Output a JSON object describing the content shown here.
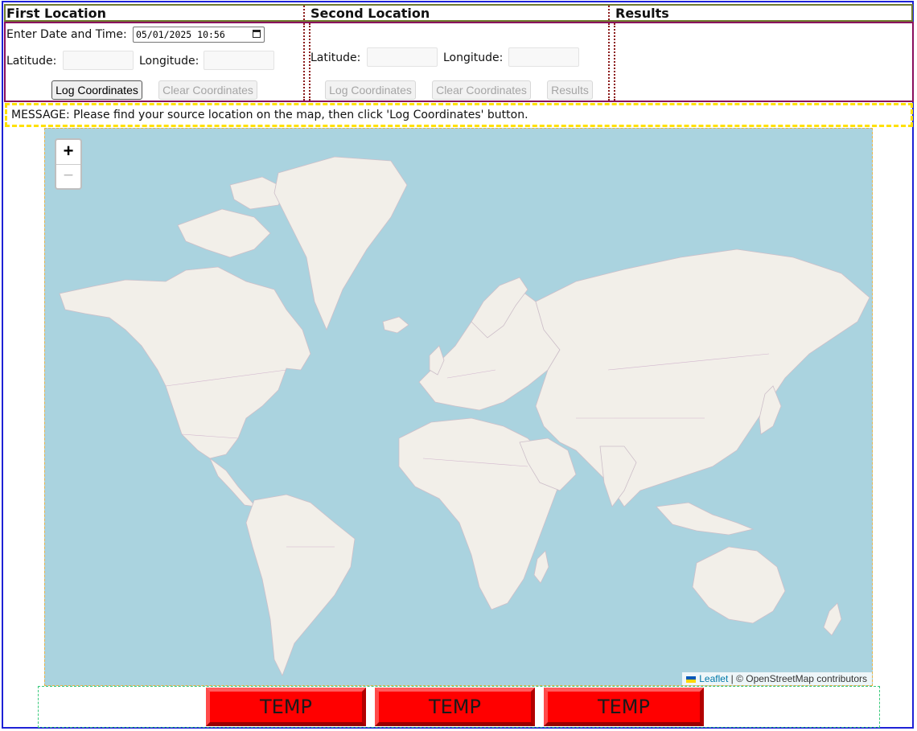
{
  "header": {
    "first_location": "First Location",
    "second_location": "Second Location",
    "results": "Results"
  },
  "first": {
    "date_label": "Enter Date and Time:",
    "date_value": "05/01/2025 10:56",
    "latitude_label": "Latitude:",
    "longitude_label": "Longitude:",
    "log_button": "Log Coordinates",
    "clear_button": "Clear Coordinates"
  },
  "second": {
    "latitude_label": "Latitude:",
    "longitude_label": "Longitude:",
    "log_button": "Log Coordinates",
    "clear_button": "Clear Coordinates",
    "results_button": "Results"
  },
  "message": "MESSAGE: Please find your source location on the map, then click 'Log Coordinates' button.",
  "map": {
    "zoom_in": "+",
    "zoom_out": "−",
    "attribution_link": "Leaflet",
    "attribution_text": "| © OpenStreetMap contributors",
    "water_color": "#aad3df",
    "land_color": "#f2efe9"
  },
  "bottom": {
    "buttons": [
      "TEMP",
      "TEMP",
      "TEMP"
    ]
  }
}
